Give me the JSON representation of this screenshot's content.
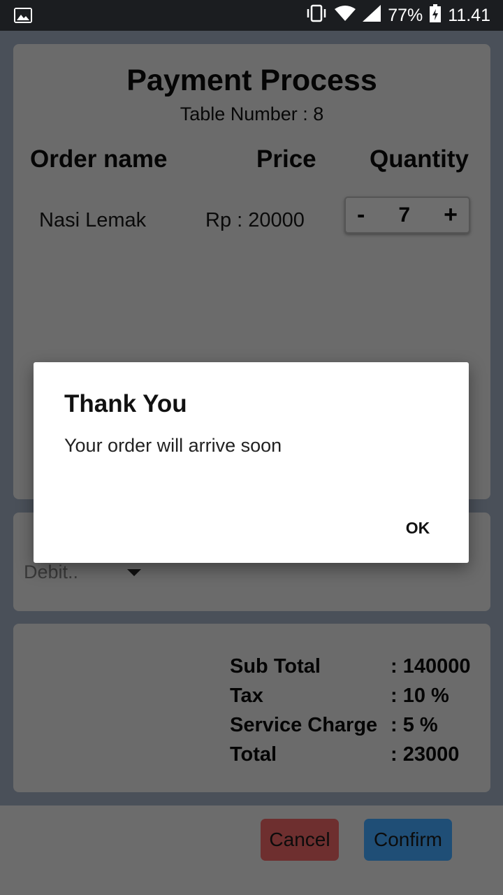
{
  "status_bar": {
    "battery_percent": "77%",
    "time": "11.41",
    "icons": [
      "gallery-icon",
      "vibrate-icon",
      "wifi-icon",
      "signal-icon",
      "battery-charging-icon"
    ]
  },
  "order": {
    "title": "Payment Process",
    "table_number": "Table Number : 8",
    "headers": {
      "name": "Order name",
      "price": "Price",
      "quantity": "Quantity"
    },
    "items": [
      {
        "name": "Nasi Lemak",
        "price": "Rp : 20000",
        "quantity": "7"
      }
    ],
    "stepper": {
      "minus": "-",
      "plus": "+"
    }
  },
  "payment": {
    "method_selected": "Debit.."
  },
  "summary": {
    "rows": [
      {
        "label": "Sub Total",
        "value": ": 140000"
      },
      {
        "label": "Tax",
        "value": ": 10 %"
      },
      {
        "label": "Service Charge",
        "value": ": 5 %"
      },
      {
        "label": "Total",
        "value": ": 23000"
      }
    ]
  },
  "actions": {
    "cancel_label": "Cancel",
    "confirm_label": "Confirm"
  },
  "dialog": {
    "title": "Thank You",
    "message": "Your order will arrive soon",
    "ok_label": "OK"
  },
  "colors": {
    "cancel": "#6e2f2f",
    "confirm": "#1f4e76",
    "dialog_bg": "#ffffff",
    "status_bar": "#1b1d20"
  }
}
